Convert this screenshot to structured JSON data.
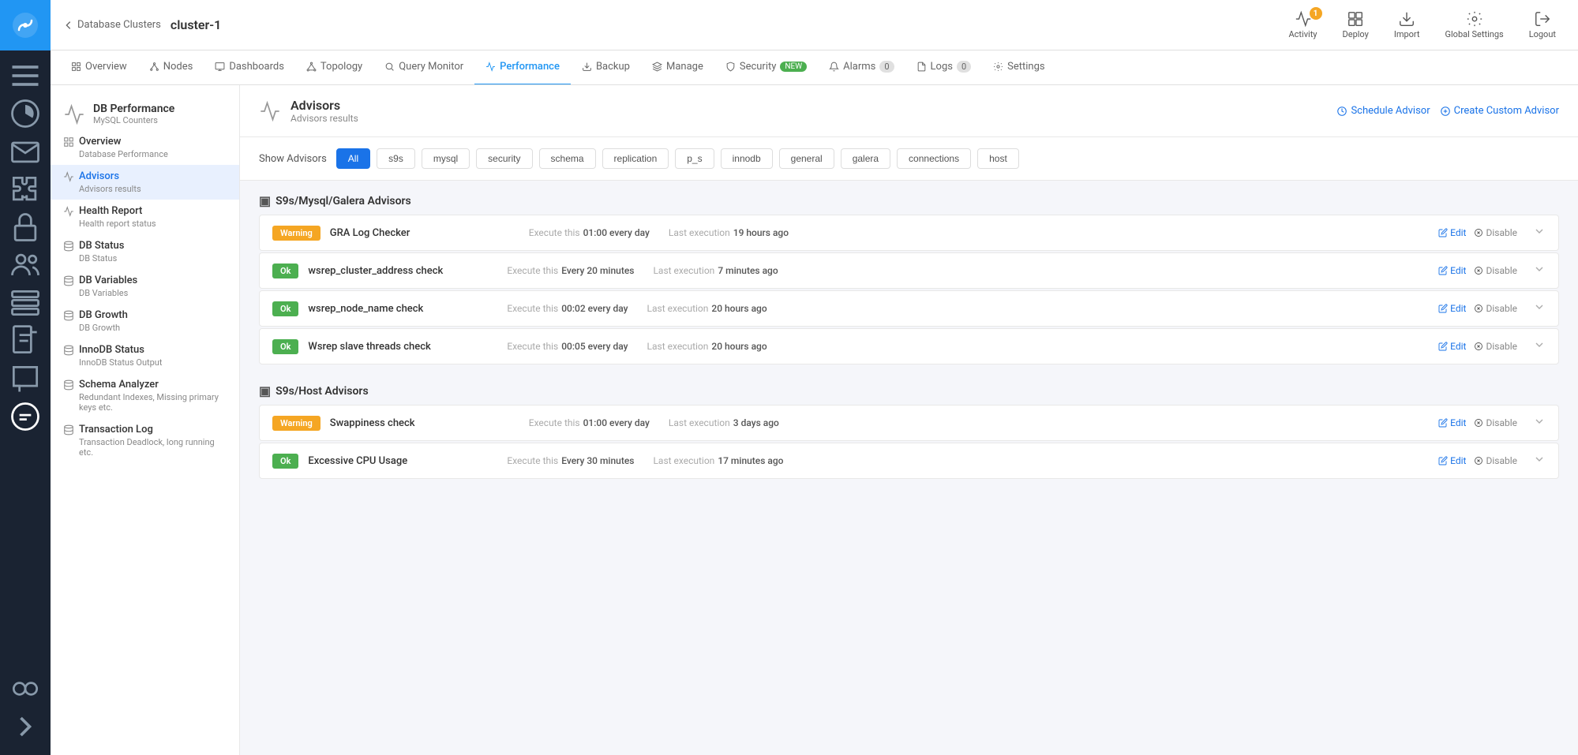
{
  "app": {
    "logo_alt": "Severalnines"
  },
  "top_bar": {
    "back_label": "Database Clusters",
    "cluster_name": "cluster-1",
    "actions": [
      {
        "id": "activity",
        "label": "Activity",
        "badge": "1"
      },
      {
        "id": "deploy",
        "label": "Deploy",
        "badge": null
      },
      {
        "id": "import",
        "label": "Import",
        "badge": null
      },
      {
        "id": "global_settings",
        "label": "Global Settings",
        "badge": null
      },
      {
        "id": "logout",
        "label": "Logout",
        "badge": null
      }
    ]
  },
  "nav_tabs": [
    {
      "id": "overview",
      "label": "Overview",
      "active": false
    },
    {
      "id": "nodes",
      "label": "Nodes",
      "active": false
    },
    {
      "id": "dashboards",
      "label": "Dashboards",
      "active": false
    },
    {
      "id": "topology",
      "label": "Topology",
      "active": false
    },
    {
      "id": "query_monitor",
      "label": "Query Monitor",
      "active": false
    },
    {
      "id": "performance",
      "label": "Performance",
      "active": true
    },
    {
      "id": "backup",
      "label": "Backup",
      "active": false
    },
    {
      "id": "manage",
      "label": "Manage",
      "active": false
    },
    {
      "id": "security",
      "label": "Security",
      "badge": "NEW",
      "active": false
    },
    {
      "id": "alarms",
      "label": "Alarms",
      "badge": "0",
      "active": false
    },
    {
      "id": "logs",
      "label": "Logs",
      "badge": "0",
      "active": false
    },
    {
      "id": "settings",
      "label": "Settings",
      "active": false
    }
  ],
  "sidebar": {
    "header_title": "DB Performance",
    "header_sub": "MySQL Counters",
    "items": [
      {
        "id": "overview",
        "label": "Overview",
        "sub": "Database Performance",
        "active": false
      },
      {
        "id": "advisors",
        "label": "Advisors",
        "sub": "Advisors results",
        "active": true
      },
      {
        "id": "health_report",
        "label": "Health Report",
        "sub": "Health report status",
        "active": false
      },
      {
        "id": "db_status",
        "label": "DB Status",
        "sub": "DB Status",
        "active": false
      },
      {
        "id": "db_variables",
        "label": "DB Variables",
        "sub": "DB Variables",
        "active": false
      },
      {
        "id": "db_growth",
        "label": "DB Growth",
        "sub": "DB Growth",
        "active": false
      },
      {
        "id": "innodb_status",
        "label": "InnoDB Status",
        "sub": "InnoDB Status Output",
        "active": false
      },
      {
        "id": "schema_analyzer",
        "label": "Schema Analyzer",
        "sub": "Redundant Indexes, Missing primary keys etc.",
        "active": false
      },
      {
        "id": "transaction_log",
        "label": "Transaction Log",
        "sub": "Transaction Deadlock, long running etc.",
        "active": false
      }
    ]
  },
  "advisors_panel": {
    "title": "Advisors",
    "sub": "Advisors results",
    "schedule_btn": "Schedule Advisor",
    "create_btn": "Create Custom Advisor",
    "filter_label": "Show Advisors",
    "filters": [
      "All",
      "s9s",
      "mysql",
      "security",
      "schema",
      "replication",
      "p_s",
      "innodb",
      "general",
      "galera",
      "connections",
      "host"
    ],
    "active_filter": "All"
  },
  "advisor_sections": [
    {
      "id": "galera_section",
      "title": "S9s/Mysql/Galera Advisors",
      "advisors": [
        {
          "id": "gra_log",
          "status": "Warning",
          "name": "GRA Log Checker",
          "execute_label": "Execute this",
          "schedule": "01:00 every day",
          "last_label": "Last execution",
          "last_exec": "19 hours ago"
        },
        {
          "id": "wsrep_cluster",
          "status": "Ok",
          "name": "wsrep_cluster_address check",
          "execute_label": "Execute this",
          "schedule": "Every 20 minutes",
          "last_label": "Last execution",
          "last_exec": "7 minutes ago"
        },
        {
          "id": "wsrep_node",
          "status": "Ok",
          "name": "wsrep_node_name check",
          "execute_label": "Execute this",
          "schedule": "00:02 every day",
          "last_label": "Last execution",
          "last_exec": "20 hours ago"
        },
        {
          "id": "wsrep_slave",
          "status": "Ok",
          "name": "Wsrep slave threads check",
          "execute_label": "Execute this",
          "schedule": "00:05 every day",
          "last_label": "Last execution",
          "last_exec": "20 hours ago"
        }
      ]
    },
    {
      "id": "host_section",
      "title": "S9s/Host Advisors",
      "advisors": [
        {
          "id": "swappiness",
          "status": "Warning",
          "name": "Swappiness check",
          "execute_label": "Execute this",
          "schedule": "01:00 every day",
          "last_label": "Last execution",
          "last_exec": "3 days ago"
        },
        {
          "id": "cpu_usage",
          "status": "Ok",
          "name": "Excessive CPU Usage",
          "execute_label": "Execute this",
          "schedule": "Every 30 minutes",
          "last_label": "Last execution",
          "last_exec": "17 minutes ago"
        }
      ]
    }
  ],
  "rail_icons": [
    {
      "id": "list",
      "label": "list-icon"
    },
    {
      "id": "chart",
      "label": "chart-icon"
    },
    {
      "id": "mail",
      "label": "mail-icon"
    },
    {
      "id": "puzzle",
      "label": "puzzle-icon"
    },
    {
      "id": "lock",
      "label": "lock-icon"
    },
    {
      "id": "users",
      "label": "users-icon"
    },
    {
      "id": "grid",
      "label": "grid-icon"
    },
    {
      "id": "doc",
      "label": "doc-icon"
    },
    {
      "id": "chat",
      "label": "chat-icon"
    },
    {
      "id": "gift",
      "label": "gift-icon"
    }
  ]
}
